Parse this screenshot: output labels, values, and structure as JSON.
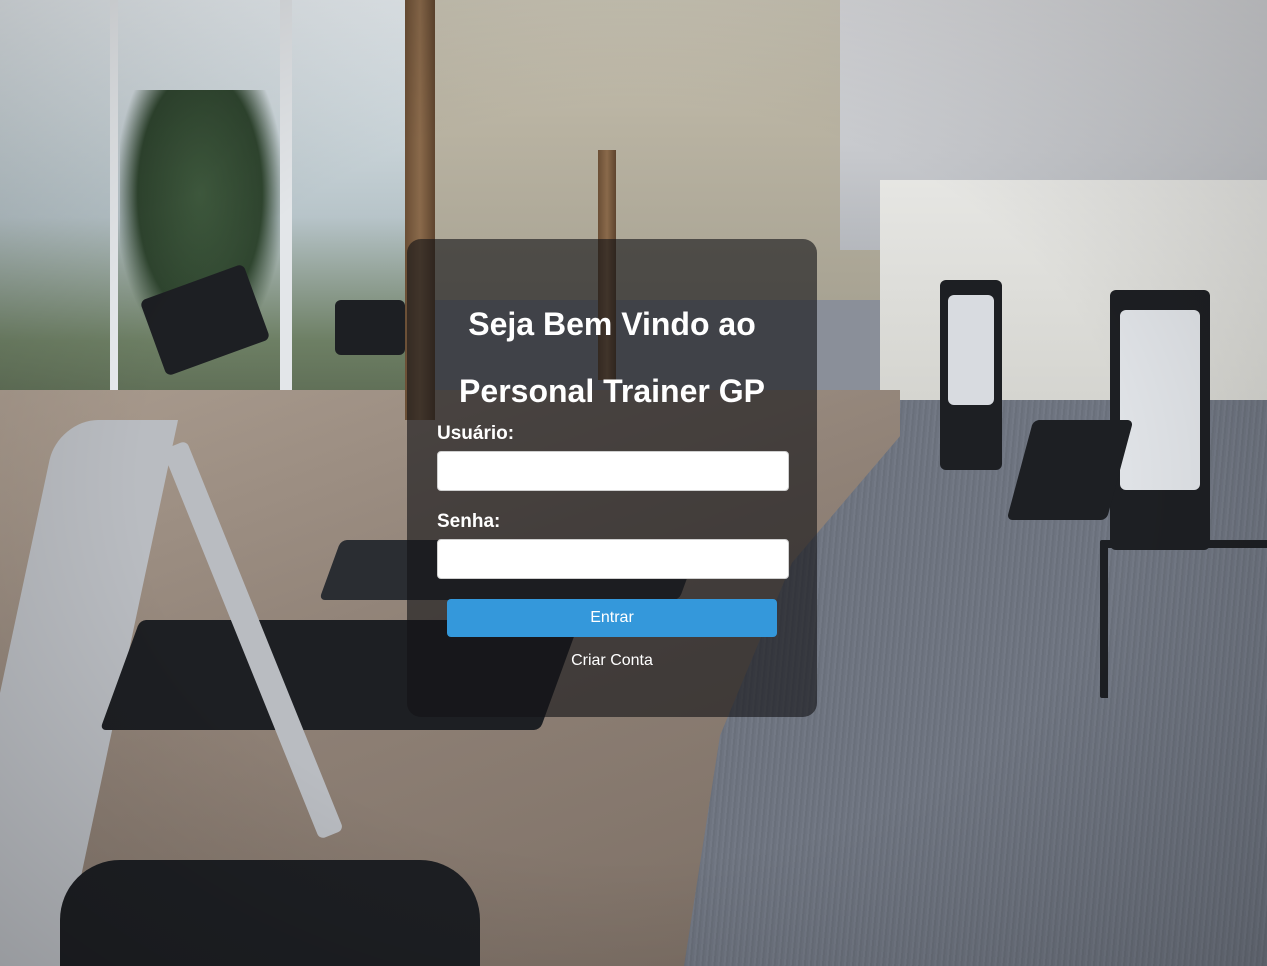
{
  "login": {
    "title_line1": "Seja Bem Vindo ao",
    "title_line2": "Personal Trainer GP",
    "username_label": "Usuário:",
    "username_value": "",
    "password_label": "Senha:",
    "password_value": "",
    "submit_label": "Entrar",
    "create_account_label": "Criar Conta"
  },
  "colors": {
    "button": "#3498db",
    "card_overlay": "rgba(20,20,22,0.62)",
    "text": "#ffffff"
  },
  "background": {
    "description_icon": "gym-background-image"
  }
}
